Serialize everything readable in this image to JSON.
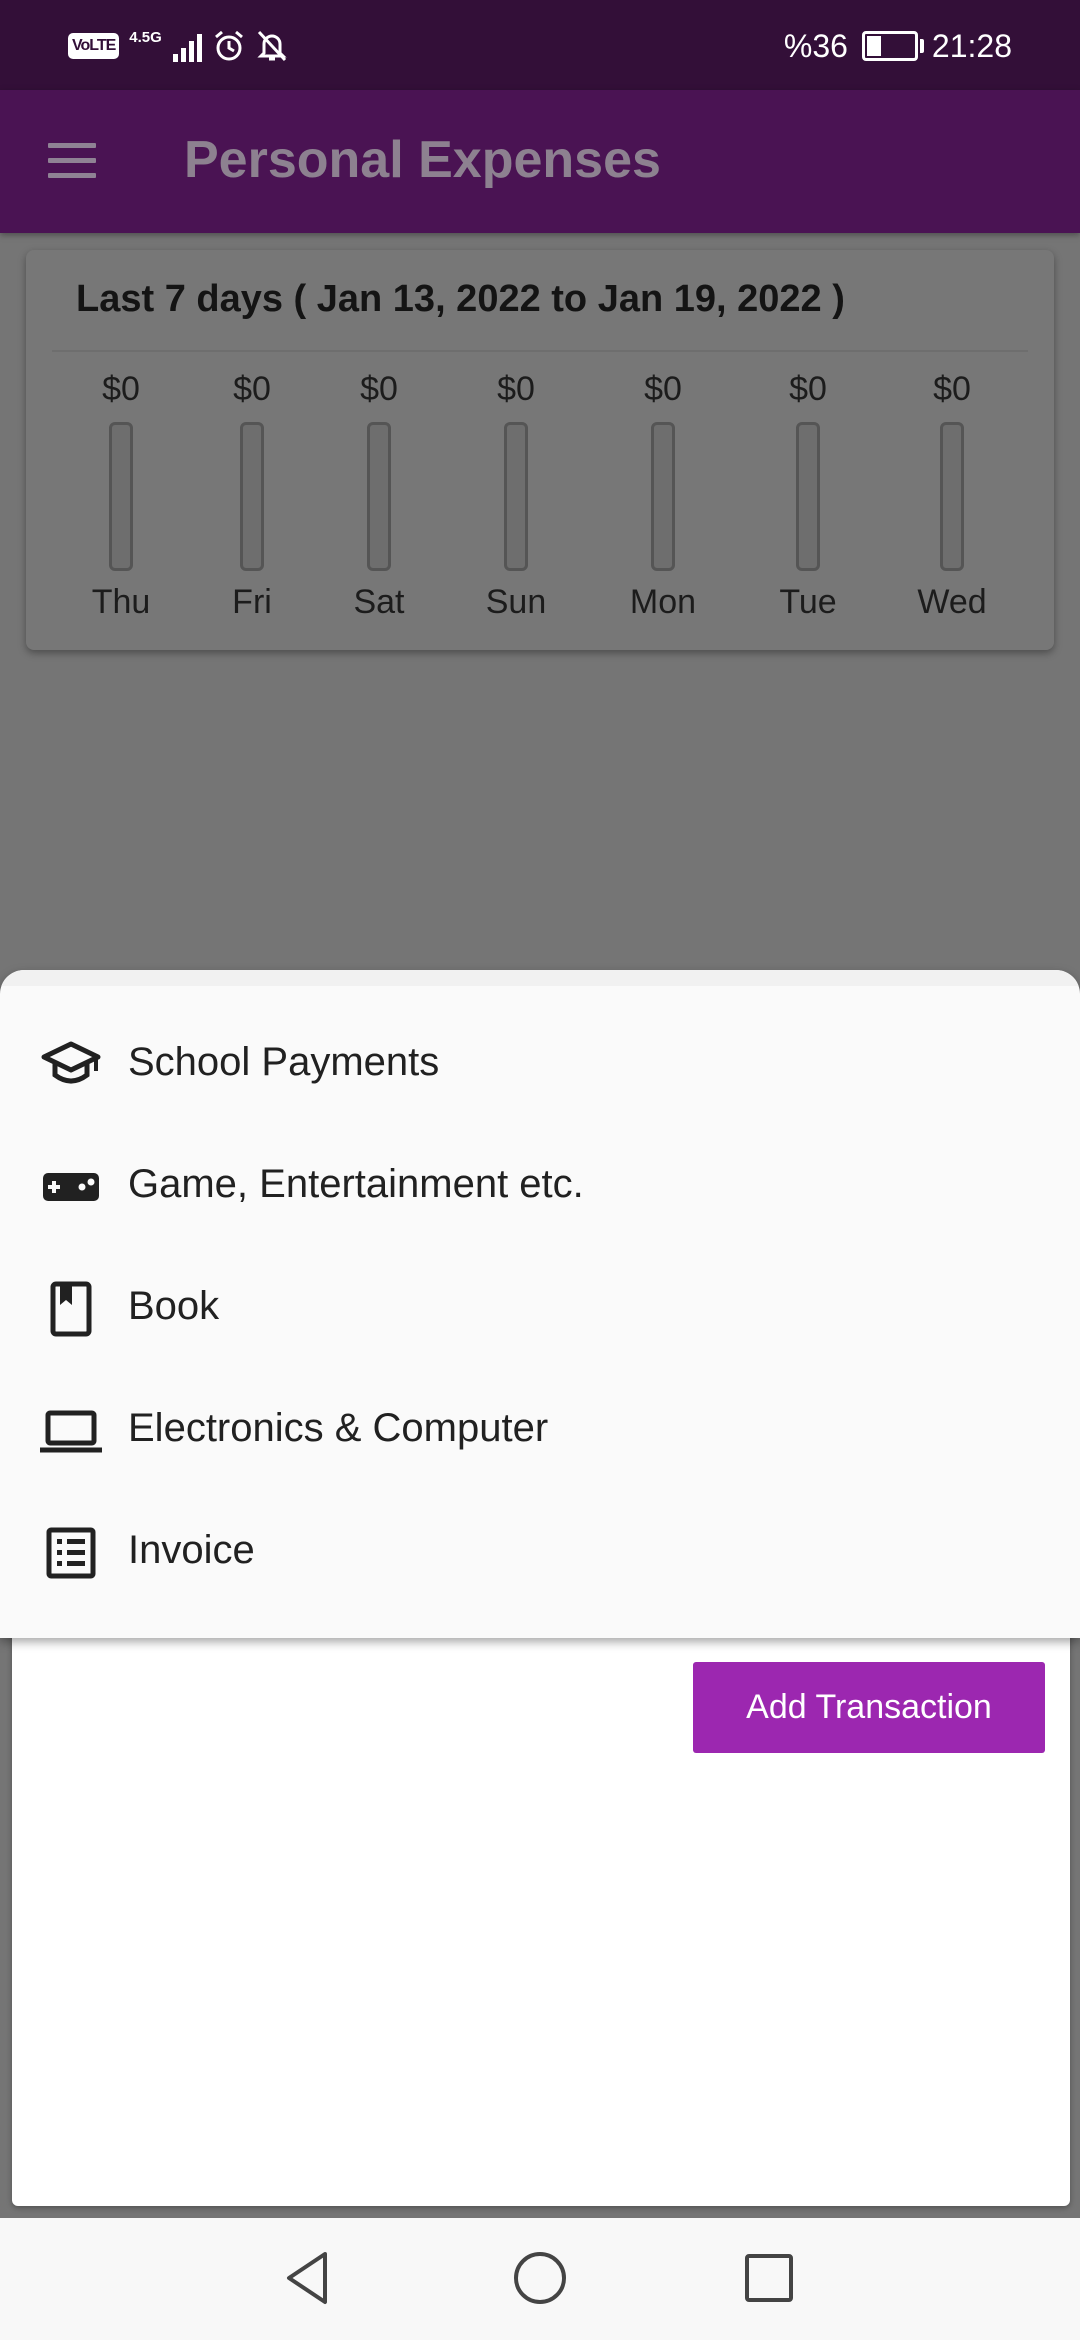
{
  "status_bar": {
    "volte": "VoLTE",
    "network": "4.5G",
    "battery_percent": "%36",
    "battery_level": 0.36,
    "time": "21:28",
    "icons": [
      "volte-icon",
      "signal-icon",
      "alarm-icon",
      "notifications-off-icon",
      "battery-charging-icon"
    ]
  },
  "app_bar": {
    "menu_icon": "menu-icon",
    "title": "Personal Expenses"
  },
  "chart_data": {
    "type": "bar",
    "title": "Last 7 days ( Jan 13, 2022 to Jan 19, 2022 )",
    "categories": [
      "Thu",
      "Fri",
      "Sat",
      "Sun",
      "Mon",
      "Tue",
      "Wed"
    ],
    "values": [
      0,
      0,
      0,
      0,
      0,
      0,
      0
    ],
    "value_labels": [
      "$0",
      "$0",
      "$0",
      "$0",
      "$0",
      "$0",
      "$0"
    ],
    "xlabel": "",
    "ylabel": "",
    "fill_color": "#9c27b0",
    "grid": false
  },
  "category_menu": {
    "items": [
      {
        "label": "School Payments",
        "icon": "school-icon"
      },
      {
        "label": "Game, Entertainment etc.",
        "icon": "gamepad-icon"
      },
      {
        "label": "Book",
        "icon": "book-icon"
      },
      {
        "label": "Electronics & Computer",
        "icon": "laptop-icon"
      },
      {
        "label": "Invoice",
        "icon": "list-alt-icon"
      }
    ]
  },
  "form": {
    "add_button_label": "Add Transaction"
  },
  "nav_bar": {
    "icons": [
      "back-icon",
      "home-icon",
      "recents-icon"
    ]
  },
  "colors": {
    "status_bar": "#330f38",
    "app_bar": "#4a1353",
    "accent": "#9c27b0",
    "scrim": "#757575",
    "menu_background": "#fafafa"
  }
}
